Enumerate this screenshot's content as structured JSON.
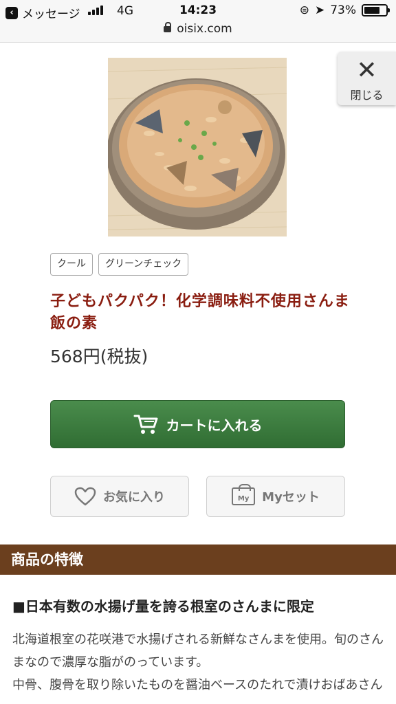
{
  "status_bar": {
    "back_app": "メッセージ",
    "network": "4G",
    "time": "14:23",
    "battery": "73%",
    "battery_level": 0.73
  },
  "browser": {
    "url": "oisix.com"
  },
  "close": {
    "icon": "close-icon",
    "label": "閉じる"
  },
  "product": {
    "tags": [
      "クール",
      "グリーンチェック"
    ],
    "title": "子どもパクパク！化学調味料不使用さんま飯の素",
    "price": "568円(税抜)"
  },
  "actions": {
    "cart_label": "カートに入れる",
    "favorite_label": "お気に入り",
    "myset_label": "Myセット",
    "myset_icon_text": "My"
  },
  "features": {
    "section_title": "商品の特徴",
    "heading": "■日本有数の水揚げ量を誇る根室のさんまに限定",
    "body": "北海道根室の花咲港で水揚げされる新鮮なさんまを使用。旬のさんまなので濃厚な脂がのっています。\n中骨、腹骨を取り除いたものを醤油ベースのたれで漬けおばあさん"
  },
  "colors": {
    "title": "#8a1d10",
    "cart_button": "#3d7d40",
    "section_header": "#6b3f1e"
  }
}
